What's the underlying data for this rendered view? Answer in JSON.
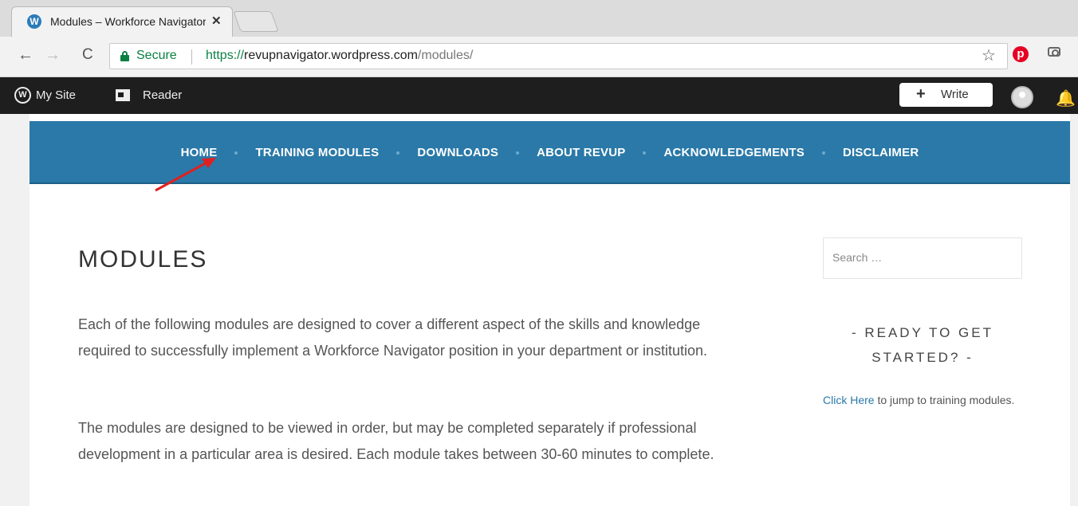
{
  "browser": {
    "tab_title": "Modules – Workforce Navigator",
    "tab_close": "✕",
    "secure_label": "Secure",
    "url_scheme": "https://",
    "url_host": "revupnavigator.wordpress.com",
    "url_path": "/modules/"
  },
  "wp_admin_bar": {
    "my_site": "My Site",
    "reader": "Reader",
    "write": "Write"
  },
  "site_nav": {
    "items": [
      "HOME",
      "TRAINING MODULES",
      "DOWNLOADS",
      "ABOUT REVUP",
      "ACKNOWLEDGEMENTS",
      "DISCLAIMER"
    ]
  },
  "main": {
    "title": "MODULES",
    "paragraph1": "Each of the following modules are designed to cover a different aspect of the skills and knowledge required to successfully implement a Workforce Navigator position in your department or institution.",
    "paragraph2": "The modules are designed to be viewed in order, but may be completed separately if professional development in a particular area is desired. Each module takes between 30-60 minutes to complete."
  },
  "sidebar": {
    "search_placeholder": "Search …",
    "widget_title": "- READY TO GET STARTED? -",
    "link_text": "Click Here",
    "link_suffix": " to jump to training modules."
  },
  "colors": {
    "nav_bg": "#2a79a8",
    "admin_bar_bg": "#1e1e1e",
    "secure_green": "#0b8043",
    "annotation_arrow": "#e02020"
  }
}
